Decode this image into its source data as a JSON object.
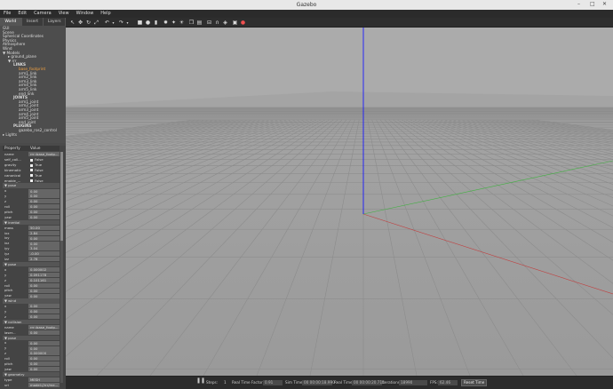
{
  "window": {
    "title": "Gazebo"
  },
  "menu": [
    "File",
    "Edit",
    "Camera",
    "View",
    "Window",
    "Help"
  ],
  "left_tabs": [
    "World",
    "Insert",
    "Layers"
  ],
  "tree": [
    {
      "label": "GUI",
      "indent": 0,
      "style": ""
    },
    {
      "label": "Scene",
      "indent": 0,
      "style": ""
    },
    {
      "label": "Spherical Coordinates",
      "indent": 0,
      "style": ""
    },
    {
      "label": "Physics",
      "indent": 0,
      "style": ""
    },
    {
      "label": "Atmosphere",
      "indent": 0,
      "style": ""
    },
    {
      "label": "Wind",
      "indent": 0,
      "style": ""
    },
    {
      "label": "▼ Models",
      "indent": 0,
      "style": ""
    },
    {
      "label": "▸ ground_plane",
      "indent": 1,
      "style": ""
    },
    {
      "label": "▼ rrr",
      "indent": 1,
      "style": ""
    },
    {
      "label": "LINKS",
      "indent": 2,
      "style": "bold"
    },
    {
      "label": "base_footprint",
      "indent": 3,
      "style": "hl"
    },
    {
      "label": "arm1_link",
      "indent": 3,
      "style": ""
    },
    {
      "label": "arm2_link",
      "indent": 3,
      "style": ""
    },
    {
      "label": "arm3_link",
      "indent": 3,
      "style": ""
    },
    {
      "label": "arm4_link",
      "indent": 3,
      "style": ""
    },
    {
      "label": "arm5_link",
      "indent": 3,
      "style": ""
    },
    {
      "label": "end_link",
      "indent": 3,
      "style": ""
    },
    {
      "label": "JOINTS",
      "indent": 2,
      "style": "bold"
    },
    {
      "label": "arm1_joint",
      "indent": 3,
      "style": ""
    },
    {
      "label": "arm2_joint",
      "indent": 3,
      "style": ""
    },
    {
      "label": "arm3_joint",
      "indent": 3,
      "style": ""
    },
    {
      "label": "arm4_joint",
      "indent": 3,
      "style": ""
    },
    {
      "label": "arm5_joint",
      "indent": 3,
      "style": ""
    },
    {
      "label": "end_joint",
      "indent": 3,
      "style": ""
    },
    {
      "label": "PLUGINS",
      "indent": 2,
      "style": "bold"
    },
    {
      "label": "gazebo_ros2_control",
      "indent": 3,
      "style": ""
    },
    {
      "label": "▸ Lights",
      "indent": 0,
      "style": ""
    }
  ],
  "props_header": {
    "property": "Property",
    "value": "Value"
  },
  "props": [
    {
      "k": "name",
      "v": "rrr::base_footp...",
      "sec": false,
      "box": true,
      "cb": false
    },
    {
      "k": "self_coll...",
      "v": "False",
      "sec": false,
      "box": false,
      "cb": true
    },
    {
      "k": "gravity",
      "v": "True",
      "sec": false,
      "box": false,
      "cb": true
    },
    {
      "k": "kinematic",
      "v": "False",
      "sec": false,
      "box": false,
      "cb": true
    },
    {
      "k": "canonical",
      "v": "True",
      "sec": false,
      "box": false,
      "cb": true
    },
    {
      "k": "enable_...",
      "v": "False",
      "sec": false,
      "box": false,
      "cb": true
    },
    {
      "k": "▼ pose",
      "v": "",
      "sec": true,
      "box": false,
      "cb": false
    },
    {
      "k": "x",
      "v": "0.00",
      "sec": false,
      "box": true,
      "cb": false
    },
    {
      "k": "y",
      "v": "0.00",
      "sec": false,
      "box": true,
      "cb": false
    },
    {
      "k": "z",
      "v": "0.00",
      "sec": false,
      "box": true,
      "cb": false
    },
    {
      "k": "roll",
      "v": "0.00",
      "sec": false,
      "box": true,
      "cb": false
    },
    {
      "k": "pitch",
      "v": "0.00",
      "sec": false,
      "box": true,
      "cb": false
    },
    {
      "k": "yaw",
      "v": "0.00",
      "sec": false,
      "box": true,
      "cb": false
    },
    {
      "k": "▼ inertial",
      "v": "",
      "sec": true,
      "box": false,
      "cb": false
    },
    {
      "k": "mass",
      "v": "50.00",
      "sec": false,
      "box": true,
      "cb": false
    },
    {
      "k": "ixx",
      "v": "2.84",
      "sec": false,
      "box": true,
      "cb": false
    },
    {
      "k": "ixy",
      "v": "0.00",
      "sec": false,
      "box": true,
      "cb": false
    },
    {
      "k": "ixz",
      "v": "0.00",
      "sec": false,
      "box": true,
      "cb": false
    },
    {
      "k": "iyy",
      "v": "3.04",
      "sec": false,
      "box": true,
      "cb": false
    },
    {
      "k": "iyz",
      "v": "-0.00",
      "sec": false,
      "box": true,
      "cb": false
    },
    {
      "k": "izz",
      "v": "2.78",
      "sec": false,
      "box": true,
      "cb": false
    },
    {
      "k": "▼ pose",
      "v": "",
      "sec": true,
      "box": false,
      "cb": false
    },
    {
      "k": "x",
      "v": "0.000002",
      "sec": false,
      "box": true,
      "cb": false
    },
    {
      "k": "y",
      "v": "0.091178",
      "sec": false,
      "box": true,
      "cb": false
    },
    {
      "k": "z",
      "v": "0.101161",
      "sec": false,
      "box": true,
      "cb": false
    },
    {
      "k": "roll",
      "v": "0.00",
      "sec": false,
      "box": true,
      "cb": false
    },
    {
      "k": "pitch",
      "v": "0.00",
      "sec": false,
      "box": true,
      "cb": false
    },
    {
      "k": "yaw",
      "v": "0.00",
      "sec": false,
      "box": true,
      "cb": false
    },
    {
      "k": "▼ wind",
      "v": "",
      "sec": true,
      "box": false,
      "cb": false
    },
    {
      "k": "x",
      "v": "0.00",
      "sec": false,
      "box": true,
      "cb": false
    },
    {
      "k": "y",
      "v": "0.00",
      "sec": false,
      "box": true,
      "cb": false
    },
    {
      "k": "z",
      "v": "0.00",
      "sec": false,
      "box": true,
      "cb": false
    },
    {
      "k": "▼ collision",
      "v": "",
      "sec": true,
      "box": false,
      "cb": false
    },
    {
      "k": "name",
      "v": "rrr::base_footp...",
      "sec": false,
      "box": true,
      "cb": false
    },
    {
      "k": "laser...",
      "v": "0.00",
      "sec": false,
      "box": true,
      "cb": false
    },
    {
      "k": "▼ pose",
      "v": "",
      "sec": true,
      "box": false,
      "cb": false
    },
    {
      "k": "x",
      "v": "0.00",
      "sec": false,
      "box": true,
      "cb": false
    },
    {
      "k": "y",
      "v": "0.00",
      "sec": false,
      "box": true,
      "cb": false
    },
    {
      "k": "z",
      "v": "0.000000",
      "sec": false,
      "box": true,
      "cb": false
    },
    {
      "k": "roll",
      "v": "0.00",
      "sec": false,
      "box": true,
      "cb": false
    },
    {
      "k": "pitch",
      "v": "0.00",
      "sec": false,
      "box": true,
      "cb": false
    },
    {
      "k": "yaw",
      "v": "0.00",
      "sec": false,
      "box": true,
      "cb": false
    },
    {
      "k": "▼ geometry",
      "v": "",
      "sec": true,
      "box": false,
      "cb": false
    },
    {
      "k": "type",
      "v": "MESH",
      "sec": false,
      "box": true,
      "cb": false
    },
    {
      "k": "uri",
      "v": "model://rrr/me...",
      "sec": false,
      "box": true,
      "cb": false
    }
  ],
  "toolbar": {
    "icons": [
      "select-icon",
      "translate-icon",
      "rotate-icon",
      "scale-icon",
      "undo-icon",
      "undo-dropdown-icon",
      "redo-icon",
      "redo-dropdown-icon",
      "box-icon",
      "sphere-icon",
      "cylinder-icon",
      "point-light-icon",
      "spot-light-icon",
      "directional-light-icon",
      "copy-icon",
      "paste-icon",
      "align-icon",
      "snap-icon",
      "change-view-icon",
      "screenshot-icon",
      "record-icon"
    ]
  },
  "bottombar": {
    "pause_icon": "pause-icon",
    "steps_label": "Steps:",
    "steps_value": "1",
    "rtf_label": "Real Time Factor:",
    "rtf_value": "0.91",
    "sim_time_label": "Sim Time:",
    "sim_time_value": "00 00:00:18.990",
    "real_time_label": "Real Time:",
    "real_time_value": "00 00:00:20.715",
    "iterations_label": "Iterations:",
    "iterations_value": "18990",
    "fps_label": "FPS:",
    "fps_value": "62.46",
    "reset_label": "Reset Time"
  },
  "colors": {
    "sky": "#ababab",
    "ground": "#9e9e9e",
    "grid": "#8a8a8a",
    "z_axis": "#1a1aff",
    "x_axis": "#c04040",
    "y_axis": "#40b040",
    "highlight": "#f0a040"
  }
}
